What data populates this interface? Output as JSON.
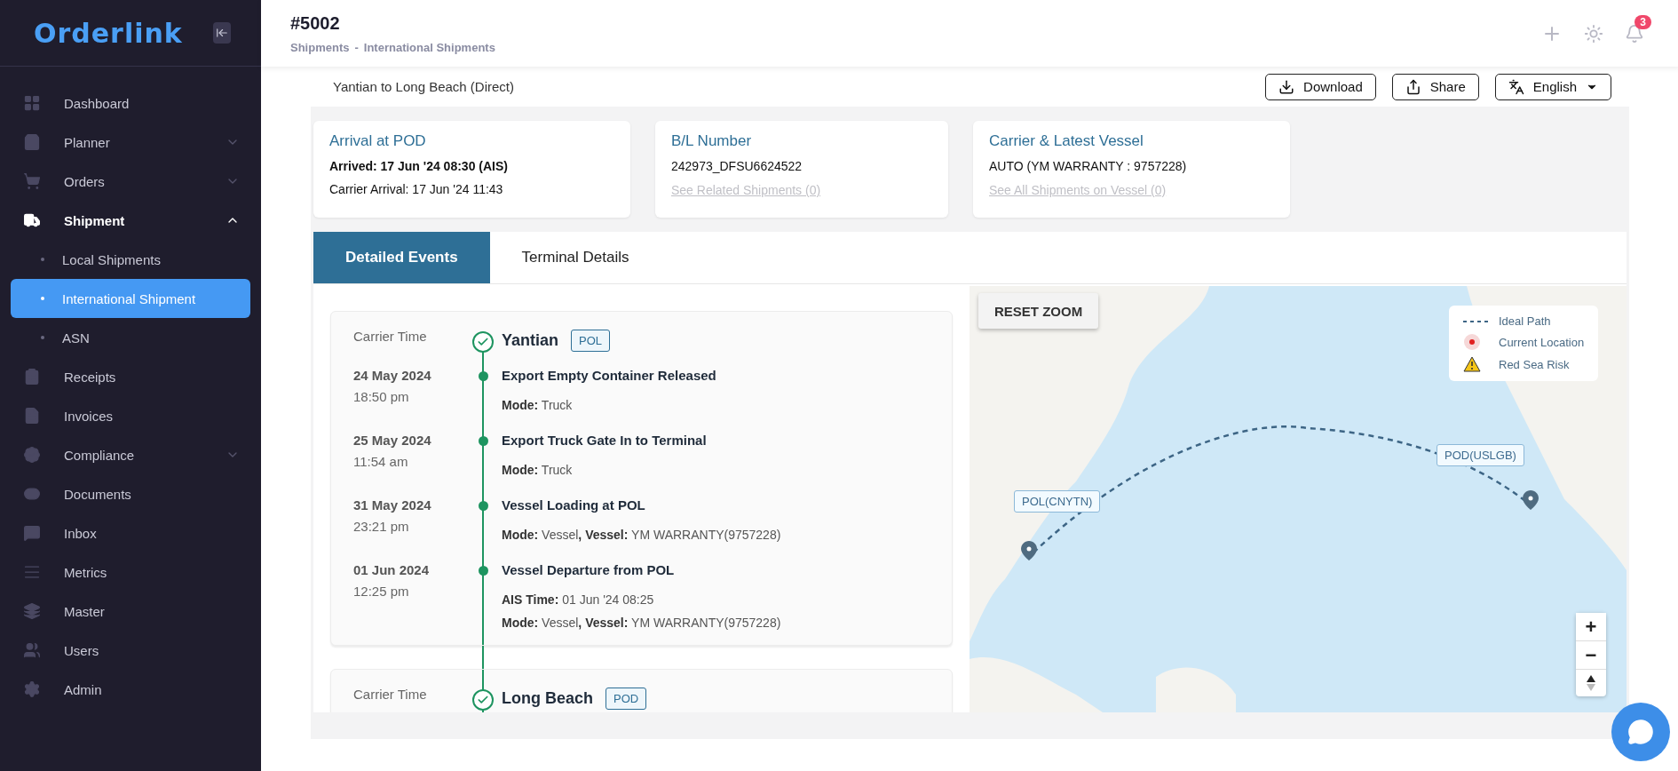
{
  "sidebar": {
    "logo": "Orderlink",
    "items": [
      {
        "label": "Dashboard",
        "selected": false
      },
      {
        "label": "Planner",
        "selected": false,
        "expanded": false
      },
      {
        "label": "Orders",
        "selected": false,
        "expanded": false
      },
      {
        "label": "Shipment",
        "selected": false,
        "expanded": true,
        "children": [
          {
            "label": "Local Shipments",
            "selected": false
          },
          {
            "label": "International Shipment",
            "selected": true
          },
          {
            "label": "ASN",
            "selected": false
          }
        ]
      },
      {
        "label": "Receipts",
        "selected": false
      },
      {
        "label": "Invoices",
        "selected": false
      },
      {
        "label": "Compliance",
        "selected": false,
        "expanded": false
      },
      {
        "label": "Documents",
        "selected": false
      },
      {
        "label": "Inbox",
        "selected": false
      },
      {
        "label": "Metrics",
        "selected": false
      },
      {
        "label": "Master",
        "selected": false
      },
      {
        "label": "Users",
        "selected": false
      },
      {
        "label": "Admin",
        "selected": false
      }
    ]
  },
  "header": {
    "title": "#5002",
    "breadcrumb": [
      "Shipments",
      "International Shipments"
    ],
    "breadcrumb_separator": "-",
    "notifications": "3"
  },
  "shipment": {
    "route": "Yantian to Long Beach (Direct)",
    "actions": [
      "Download",
      "Share",
      "English"
    ]
  },
  "info_cards": [
    {
      "title": "Arrival at POD",
      "lines": [
        {
          "text": "Arrived: 17 Jun '24 08:30 (AIS)",
          "bold": true
        },
        {
          "text": "Carrier Arrival: 17 Jun '24 11:43",
          "bold": false
        }
      ]
    },
    {
      "title": "B/L Number",
      "lines": [
        {
          "text": "242973_DFSU6624522",
          "bold": false
        }
      ],
      "link": {
        "text": "See Related Shipments (0)",
        "disabled": true
      }
    },
    {
      "title": "Carrier & Latest Vessel",
      "lines": [
        {
          "text": "AUTO (YM WARRANTY : 9757228)",
          "bold": false
        }
      ],
      "link": {
        "text": "See All Shipments on Vessel (0)",
        "disabled": true
      }
    }
  ],
  "tabs": [
    {
      "label": "Detailed Events",
      "selected": true
    },
    {
      "label": "Terminal Details",
      "selected": false
    }
  ],
  "timeline": [
    {
      "time_label": "Carrier Time",
      "place": "Yantian",
      "badge": "POL",
      "done": true,
      "events": [
        {
          "date": "24 May 2024",
          "time": "18:50 pm",
          "title": "Export Empty Container Released",
          "details": [
            "**Mode:** Truck"
          ]
        },
        {
          "date": "25 May 2024",
          "time": "11:54 am",
          "title": "Export Truck Gate In to Terminal",
          "details": [
            "**Mode:** Truck"
          ]
        },
        {
          "date": "31 May 2024",
          "time": "23:21 pm",
          "title": "Vessel Loading at POL",
          "details": [
            "**Mode:** Vessel**, Vessel:** YM WARRANTY(9757228)"
          ]
        },
        {
          "date": "01 Jun 2024",
          "time": "12:25 pm",
          "title": "Vessel Departure from POL",
          "details": [
            "**AIS Time:** 01 Jun '24 08:25",
            "**Mode:** Vessel**, Vessel:** YM WARRANTY(9757228)"
          ]
        }
      ]
    },
    {
      "time_label": "Carrier Time",
      "place": "Long Beach",
      "badge": "POD",
      "done": true
    }
  ],
  "map": {
    "reset_button": "RESET ZOOM",
    "legend": [
      {
        "kind": "dashed",
        "label": "Ideal Path"
      },
      {
        "kind": "dot",
        "label": "Current Location"
      },
      {
        "kind": "warning",
        "label": "Red Sea Risk"
      }
    ],
    "ports": [
      {
        "kind": "origin",
        "label": "POL(CNYTN)"
      },
      {
        "kind": "destination",
        "label": "POD(USLGB)"
      }
    ],
    "zoom_controls": [
      "+",
      "−"
    ]
  }
}
